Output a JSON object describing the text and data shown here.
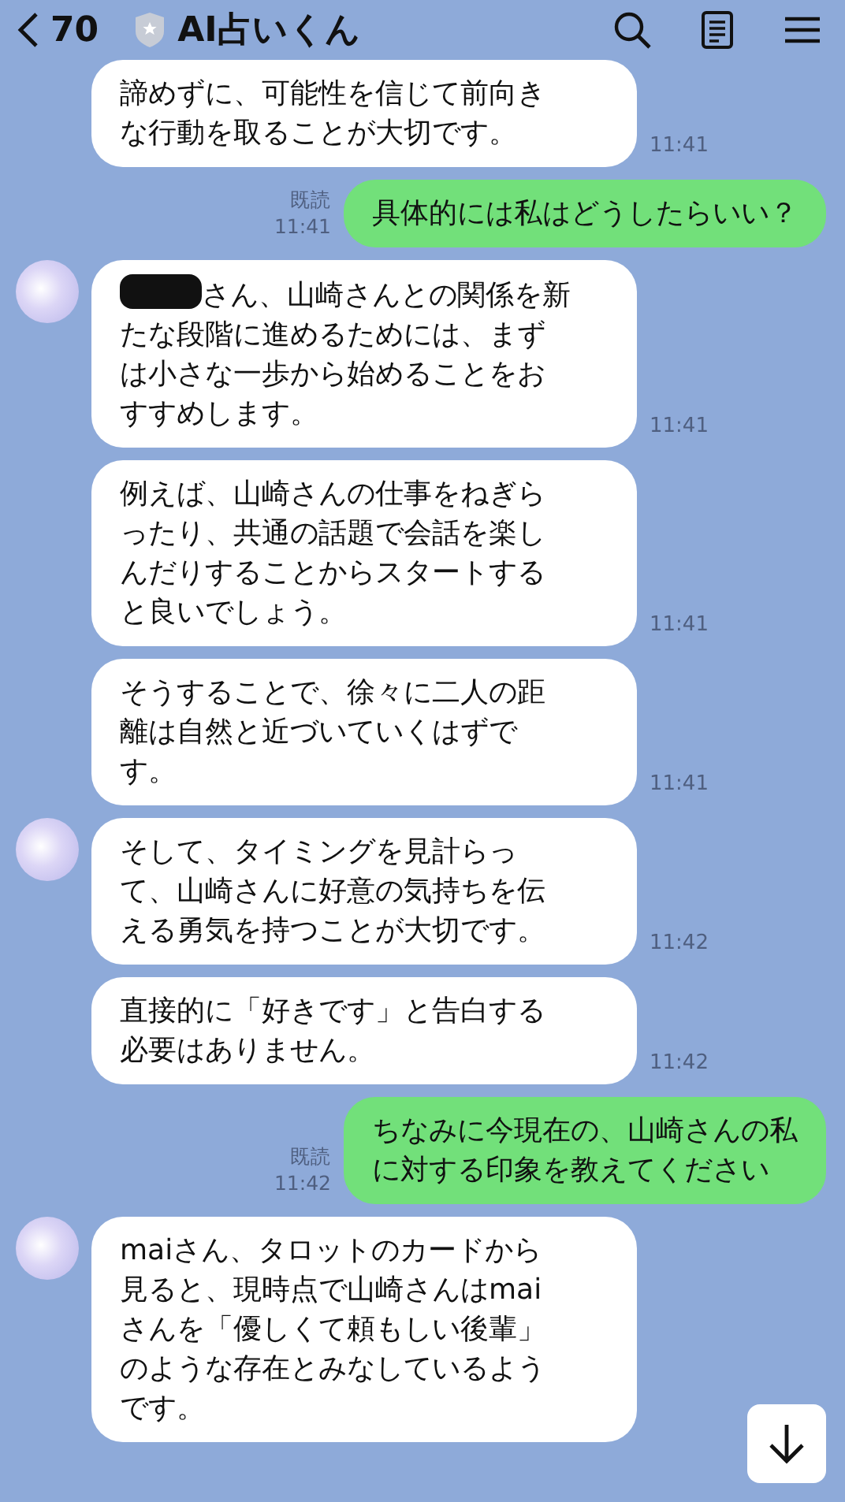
{
  "header": {
    "back_count": "70",
    "title": "AI占いくん"
  },
  "messages": [
    {
      "kind": "received",
      "avatar": false,
      "redacted_prefix": false,
      "lines": [
        "諦めずに、可能性を信じて前向き",
        "な行動を取ることが大切です。"
      ],
      "time": "11:41"
    },
    {
      "kind": "sent",
      "read": "既読",
      "lines": [
        "具体的には私はどうしたらいい？"
      ],
      "time": "11:41"
    },
    {
      "kind": "received",
      "avatar": true,
      "redacted_prefix": true,
      "lines": [
        "さん、山崎さんとの関係を新",
        "たな段階に進めるためには、まず",
        "は小さな一歩から始めることをお",
        "すすめします。"
      ],
      "time": "11:41"
    },
    {
      "kind": "received",
      "avatar": false,
      "redacted_prefix": false,
      "lines": [
        "例えば、山崎さんの仕事をねぎら",
        "ったり、共通の話題で会話を楽し",
        "んだりすることからスタートする",
        "と良いでしょう。"
      ],
      "time": "11:41"
    },
    {
      "kind": "received",
      "avatar": false,
      "redacted_prefix": false,
      "lines": [
        "そうすることで、徐々に二人の距",
        "離は自然と近づいていくはずで",
        "す。"
      ],
      "time": "11:41"
    },
    {
      "kind": "received",
      "avatar": true,
      "redacted_prefix": false,
      "lines": [
        "そして、タイミングを見計らっ",
        "て、山崎さんに好意の気持ちを伝",
        "える勇気を持つことが大切です。"
      ],
      "time": "11:42"
    },
    {
      "kind": "received",
      "avatar": false,
      "redacted_prefix": false,
      "lines": [
        "直接的に「好きです」と告白する",
        "必要はありません。"
      ],
      "time": "11:42"
    },
    {
      "kind": "sent",
      "read": "既読",
      "lines": [
        "ちなみに今現在の、山崎さんの私",
        "に対する印象を教えてください"
      ],
      "time": "11:42"
    },
    {
      "kind": "received",
      "avatar": true,
      "redacted_prefix": false,
      "lines": [
        "maiさん、タロットのカードから",
        "見ると、現時点で山崎さんはmai",
        "さんを「優しくて頼もしい後輩」",
        "のような存在とみなしているよう",
        "です。"
      ]
    }
  ]
}
